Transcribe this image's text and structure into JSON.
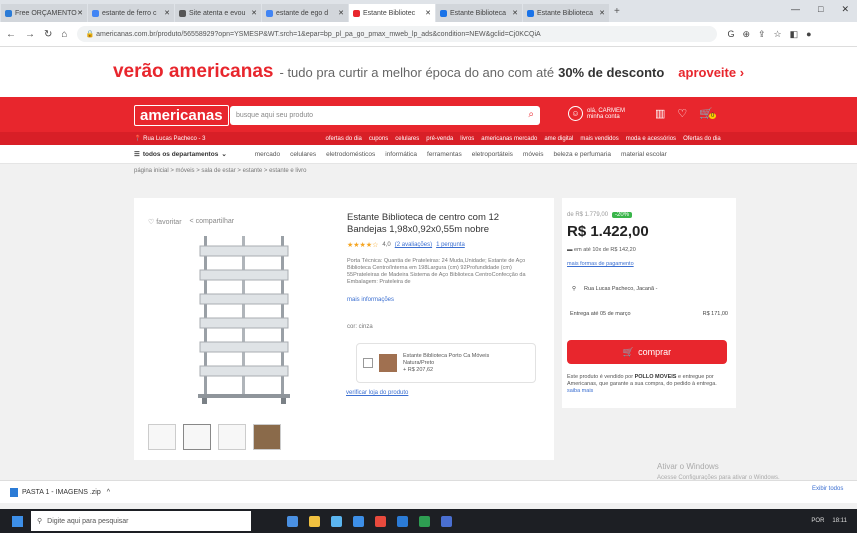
{
  "browser": {
    "tabs": [
      {
        "label": "Free ORÇAMENTO",
        "color": "#2b7bd6",
        "active": false
      },
      {
        "label": "estante de ferro c",
        "color": "#4285f4",
        "active": false
      },
      {
        "label": "Site atenta e evou",
        "color": "#555555",
        "active": false
      },
      {
        "label": "estante de ego d",
        "color": "#4285f4",
        "active": false
      },
      {
        "label": "Estante Bibliotec",
        "color": "#e8262d",
        "active": true
      },
      {
        "label": "Estante Biblioteca",
        "color": "#1a73e8",
        "active": false
      },
      {
        "label": "Estante Biblioteca",
        "color": "#1a73e8",
        "active": false
      }
    ],
    "new_tab": "+",
    "url": "americanas.com.br/produto/56558929?opn=YSMESP&WT.srch=1&epar=bp_pl_pa_go_pmax_mweb_lp_ads&condition=NEW&gclid=Cj0KCQiA",
    "window_controls": [
      "—",
      "□",
      "✕"
    ]
  },
  "promo": {
    "highlight": "verão americanas",
    "text": "- tudo pra curtir a melhor época do ano com até",
    "percent": "30% de desconto",
    "cta": "aproveite ›"
  },
  "header": {
    "logo": "americanas",
    "search_placeholder": "busque aqui seu produto",
    "user_line1": "olá, CARMEM",
    "user_line2": "minha conta",
    "cart_count": "0",
    "cep": "Rua Lucas Pacheco - 3",
    "sublinks": [
      "ofertas do dia",
      "cupons",
      "celulares",
      "pré-venda",
      "livros",
      "americanas mercado",
      "ame digital",
      "mais vendidos",
      "moda e acessórios",
      "Ofertas do dia"
    ]
  },
  "departments": {
    "all_label": "todos os departamentos",
    "links": [
      "mercado",
      "celulares",
      "eletrodomésticos",
      "informática",
      "ferramentas",
      "eletroportáteis",
      "móveis",
      "beleza e perfumaria",
      "material escolar"
    ]
  },
  "breadcrumb": "página inicial > móveis > sala de estar > estante > estante e livro",
  "product": {
    "share_label": "favoritar",
    "share2_label": "compartilhar",
    "title": "Estante Biblioteca de centro com 12 Bandejas 1,98x0,92x0,55m nobre",
    "stars": "★★★★☆",
    "rating": "4,0",
    "reviews": "(2 avaliações)",
    "question_link": "1 pergunta",
    "description": "Porta Técnica: Quantia de Prateleiras: 24 Muda,Unidade; Estante de Aço Biblioteca Centro/Interna em 198Largura (cm) 92Profundidade (cm) 55Prateleiras de Madeira Sistema de Aço Biblioteca CentroConfecção da Embalagem: Prateleira de",
    "more_info": "mais informações",
    "color_label": "cor: cinza",
    "kit_text1": "Estante Biblioteca Porto Ca Móveis",
    "kit_text2": "Natura/Preto",
    "kit_price": "+ R$ 207,62",
    "verify_link": "verificar loja do produto",
    "thumbnails": 4
  },
  "price_panel": {
    "old_price": "de R$ 1.779,00",
    "discount": "-20%",
    "price": "R$ 1.422,00",
    "installments": "em até 10x de R$ 142,20",
    "payment_link": "mais formas de pagamento",
    "address": "Rua Lucas Pacheco, Jacanã -",
    "delivery_date": "Entrega até 05 de março",
    "delivery_price": "R$ 171,00",
    "buy_label": "comprar",
    "seller_text1": "Este produto é vendido por",
    "seller_name": "POLLO MOVEIS",
    "seller_text2": "e entregue por Americanas, que garante a sua compra, do pedido à entrega.",
    "seller_link": "saiba mais"
  },
  "watermark": {
    "line1": "Ativar o Windows",
    "line2": "Acesse Configurações para ativar o Windows."
  },
  "download_bar": {
    "file": "PASTA 1 - IMAGENS .zip",
    "chevron": "^",
    "show_all": "Exibir todos"
  },
  "taskbar": {
    "search_placeholder": "Digite aqui para pesquisar",
    "time": "18:11",
    "lang": "POR",
    "icons": [
      "#4a90e2",
      "#f0c040",
      "#5bb5f0",
      "#3d8fe8",
      "#e84a3d",
      "#2b7bd6",
      "#2e9e52",
      "#4a6fd1"
    ]
  }
}
